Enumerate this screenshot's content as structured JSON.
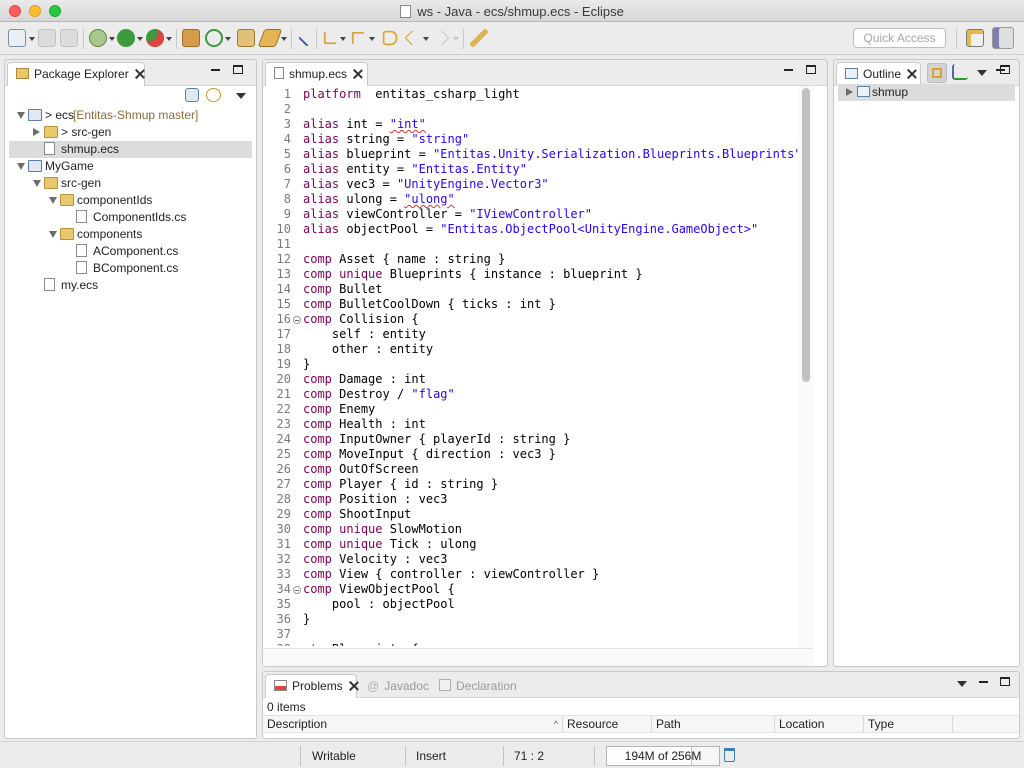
{
  "window": {
    "title": "ws - Java - ecs/shmup.ecs - Eclipse"
  },
  "toolbar": {
    "quick_access_placeholder": "Quick Access"
  },
  "package_explorer": {
    "tab_label": "Package Explorer",
    "tree": [
      {
        "label": "> ecs",
        "branch": " [Entitas-Shmup master]",
        "depth": 0,
        "state": "open",
        "icon": "project-icon"
      },
      {
        "label": "> src-gen",
        "depth": 1,
        "state": "closed",
        "icon": "folder-icon"
      },
      {
        "label": "shmup.ecs",
        "depth": 1,
        "state": "leaf",
        "icon": "file-icon",
        "selected": true
      },
      {
        "label": "MyGame",
        "depth": 0,
        "state": "open",
        "icon": "project-icon"
      },
      {
        "label": "src-gen",
        "depth": 1,
        "state": "open",
        "icon": "folder-icon"
      },
      {
        "label": "componentIds",
        "depth": 2,
        "state": "open",
        "icon": "folder-icon"
      },
      {
        "label": "ComponentIds.cs",
        "depth": 3,
        "state": "leaf",
        "icon": "file-icon"
      },
      {
        "label": "components",
        "depth": 2,
        "state": "open",
        "icon": "folder-icon"
      },
      {
        "label": "AComponent.cs",
        "depth": 3,
        "state": "leaf",
        "icon": "file-icon"
      },
      {
        "label": "BComponent.cs",
        "depth": 3,
        "state": "leaf",
        "icon": "file-icon"
      },
      {
        "label": "my.ecs",
        "depth": 1,
        "state": "leaf",
        "icon": "file-icon"
      }
    ]
  },
  "editor": {
    "tab_label": "shmup.ecs",
    "lines": [
      {
        "n": "1",
        "tokens": [
          [
            "kw",
            "platform"
          ],
          [
            "",
            "",
            " entitas_csharp_light"
          ]
        ]
      },
      {
        "n": "2",
        "tokens": []
      },
      {
        "n": "3",
        "tokens": [
          [
            "kw",
            "alias"
          ],
          [
            "",
            "int = "
          ],
          [
            "str",
            "\"int\""
          ]
        ]
      },
      {
        "n": "4",
        "tokens": [
          [
            "kw",
            "alias"
          ],
          [
            "",
            "string = "
          ],
          [
            "str",
            "\"string\""
          ]
        ]
      },
      {
        "n": "5",
        "tokens": [
          [
            "kw",
            "alias"
          ],
          [
            "",
            "blueprint = "
          ],
          [
            "str",
            "\"Entitas.Unity.Serialization.Blueprints.Blueprints\""
          ]
        ]
      },
      {
        "n": "6",
        "tokens": [
          [
            "kw",
            "alias"
          ],
          [
            "",
            "entity = "
          ],
          [
            "str",
            "\"Entitas.Entity\""
          ]
        ]
      },
      {
        "n": "7",
        "tokens": [
          [
            "kw",
            "alias"
          ],
          [
            "",
            "vec3 = "
          ],
          [
            "str",
            "\"UnityEngine.Vector3\""
          ]
        ]
      },
      {
        "n": "8",
        "tokens": [
          [
            "kw",
            "alias"
          ],
          [
            "",
            "ulong = "
          ],
          [
            "str",
            "\"ulong\""
          ]
        ]
      },
      {
        "n": "9",
        "tokens": [
          [
            "kw",
            "alias"
          ],
          [
            "",
            "viewController = "
          ],
          [
            "str",
            "\"IViewController\""
          ]
        ]
      },
      {
        "n": "10",
        "tokens": [
          [
            "kw",
            "alias"
          ],
          [
            "",
            "objectPool = "
          ],
          [
            "str",
            "\"Entitas.ObjectPool<UnityEngine.GameObject>\""
          ]
        ]
      },
      {
        "n": "11",
        "tokens": []
      },
      {
        "n": "12",
        "tokens": [
          [
            "kw",
            "comp"
          ],
          [
            "",
            "Asset { name : string }"
          ]
        ]
      },
      {
        "n": "13",
        "tokens": [
          [
            "kw",
            "comp"
          ],
          [
            "kw",
            "unique"
          ],
          [
            "",
            "Blueprints { instance : blueprint }"
          ]
        ]
      },
      {
        "n": "14",
        "tokens": [
          [
            "kw",
            "comp"
          ],
          [
            "",
            "Bullet"
          ]
        ]
      },
      {
        "n": "15",
        "tokens": [
          [
            "kw",
            "comp"
          ],
          [
            "",
            "BulletCoolDown { ticks : int }"
          ]
        ]
      },
      {
        "n": "16",
        "fold": true,
        "tokens": [
          [
            "kw",
            "comp"
          ],
          [
            "",
            "Collision {"
          ]
        ]
      },
      {
        "n": "17",
        "tokens": [
          [
            "",
            "    self : entity"
          ]
        ]
      },
      {
        "n": "18",
        "tokens": [
          [
            "",
            "    other : entity"
          ]
        ]
      },
      {
        "n": "19",
        "tokens": [
          [
            "",
            "}"
          ]
        ]
      },
      {
        "n": "20",
        "tokens": [
          [
            "kw",
            "comp"
          ],
          [
            "",
            "Damage : int"
          ]
        ]
      },
      {
        "n": "21",
        "tokens": [
          [
            "kw",
            "comp"
          ],
          [
            "",
            "Destroy / "
          ],
          [
            "str",
            "\"flag\""
          ]
        ]
      },
      {
        "n": "22",
        "tokens": [
          [
            "kw",
            "comp"
          ],
          [
            "",
            "Enemy"
          ]
        ]
      },
      {
        "n": "23",
        "tokens": [
          [
            "kw",
            "comp"
          ],
          [
            "",
            "Health : int"
          ]
        ]
      },
      {
        "n": "24",
        "tokens": [
          [
            "kw",
            "comp"
          ],
          [
            "",
            "InputOwner { playerId : string }"
          ]
        ]
      },
      {
        "n": "25",
        "tokens": [
          [
            "kw",
            "comp"
          ],
          [
            "",
            "MoveInput { direction : vec3 }"
          ]
        ]
      },
      {
        "n": "26",
        "tokens": [
          [
            "kw",
            "comp"
          ],
          [
            "",
            "OutOfScreen"
          ]
        ]
      },
      {
        "n": "27",
        "tokens": [
          [
            "kw",
            "comp"
          ],
          [
            "",
            "Player { id : string }"
          ]
        ]
      },
      {
        "n": "28",
        "tokens": [
          [
            "kw",
            "comp"
          ],
          [
            "",
            "Position : vec3"
          ]
        ]
      },
      {
        "n": "29",
        "tokens": [
          [
            "kw",
            "comp"
          ],
          [
            "",
            "ShootInput"
          ]
        ]
      },
      {
        "n": "30",
        "tokens": [
          [
            "kw",
            "comp"
          ],
          [
            "kw",
            "unique"
          ],
          [
            "",
            "SlowMotion"
          ]
        ]
      },
      {
        "n": "31",
        "tokens": [
          [
            "kw",
            "comp"
          ],
          [
            "kw",
            "unique"
          ],
          [
            "",
            "Tick : ulong"
          ]
        ]
      },
      {
        "n": "32",
        "tokens": [
          [
            "kw",
            "comp"
          ],
          [
            "",
            "Velocity : vec3"
          ]
        ]
      },
      {
        "n": "33",
        "tokens": [
          [
            "kw",
            "comp"
          ],
          [
            "",
            "View { controller : viewController }"
          ]
        ]
      },
      {
        "n": "34",
        "fold": true,
        "tokens": [
          [
            "kw",
            "comp"
          ],
          [
            "",
            "ViewObjectPool {"
          ]
        ]
      },
      {
        "n": "35",
        "tokens": [
          [
            "",
            "    pool : objectPool"
          ]
        ]
      },
      {
        "n": "36",
        "tokens": [
          [
            "",
            "}"
          ]
        ]
      },
      {
        "n": "37",
        "tokens": []
      },
      {
        "n": "38",
        "fold": true,
        "tokens": [
          [
            "kw",
            "ctx"
          ],
          [
            "",
            "Blueprints {"
          ]
        ]
      }
    ]
  },
  "outline": {
    "tab_label": "Outline",
    "items": [
      {
        "label": "shmup"
      }
    ]
  },
  "problems": {
    "tabs": [
      {
        "label": "Problems",
        "active": true
      },
      {
        "label": "Javadoc",
        "active": false
      },
      {
        "label": "Declaration",
        "active": false
      }
    ],
    "count": "0 items",
    "columns": [
      "Description",
      "Resource",
      "Path",
      "Location",
      "Type"
    ]
  },
  "status": {
    "writable": "Writable",
    "insert_mode": "Insert",
    "cursor": "71 : 2",
    "heap": "194M of 256M",
    "heap_used_fraction": 0.76
  },
  "colors": {
    "keyword": "#7f0055",
    "string": "#2a00ff",
    "selection": "#dcdcdc"
  }
}
